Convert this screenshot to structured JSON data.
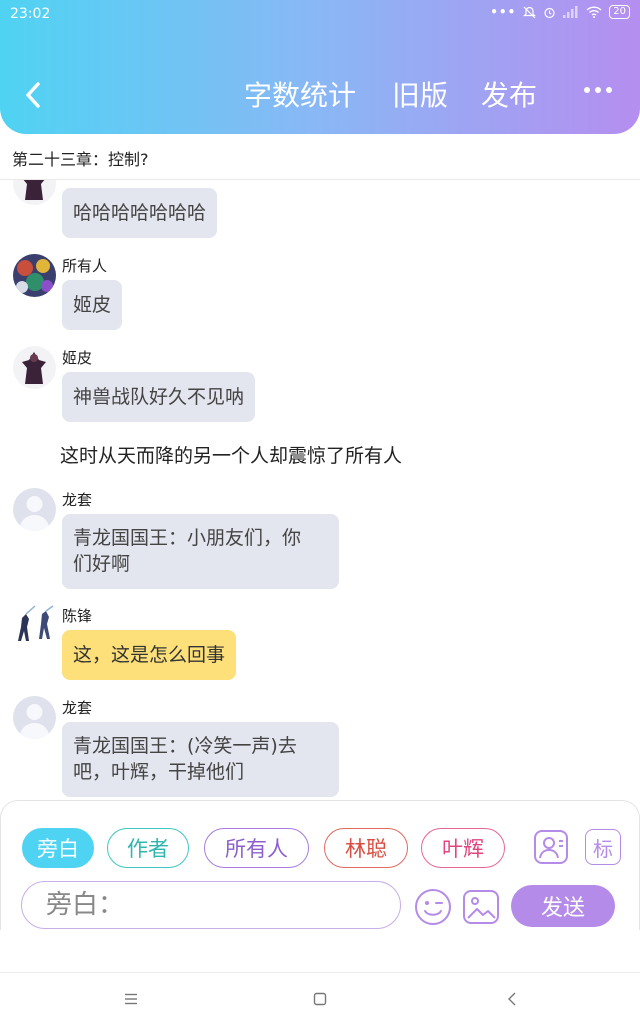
{
  "status_bar": {
    "time": "23:02",
    "battery": "20"
  },
  "header": {
    "word_count_label": "字数统计",
    "old_version_label": "旧版",
    "publish_label": "发布"
  },
  "chapter": {
    "title": "第二十三章：控制?"
  },
  "messages": [
    {
      "type": "bubble",
      "sender": "",
      "text": "哈哈哈哈哈哈哈",
      "bubble_color": "#e3e6ef"
    },
    {
      "type": "bubble",
      "sender": "所有人",
      "text": "姬皮",
      "bubble_color": "#e3e6ef"
    },
    {
      "type": "bubble",
      "sender": "姬皮",
      "text": "神兽战队好久不见呐",
      "bubble_color": "#e3e6ef"
    },
    {
      "type": "narration",
      "text": "这时从天而降的另一个人却震惊了所有人"
    },
    {
      "type": "bubble",
      "sender": "龙套",
      "text_lines": [
        "青龙国国王：小朋友们，你",
        "们好啊"
      ],
      "bubble_color": "#e3e6ef"
    },
    {
      "type": "bubble",
      "sender": "陈锋",
      "text": "这，这是怎么回事",
      "bubble_color": "#fde07a"
    },
    {
      "type": "bubble",
      "sender": "龙套",
      "text_lines": [
        "青龙国国王：(冷笑一声)去",
        "吧，叶辉，干掉他们"
      ],
      "bubble_color": "#e3e6ef"
    }
  ],
  "input_panel": {
    "roles": [
      "旁白",
      "作者",
      "所有人",
      "林聪",
      "叶辉"
    ],
    "selected_role": "旁白",
    "tag_label": "标",
    "input_placeholder": "旁白：",
    "send_label": "发送"
  },
  "colors": {
    "accent": "#b48be8",
    "header_start": "#4fd3f3",
    "header_end": "#b58ef0"
  }
}
